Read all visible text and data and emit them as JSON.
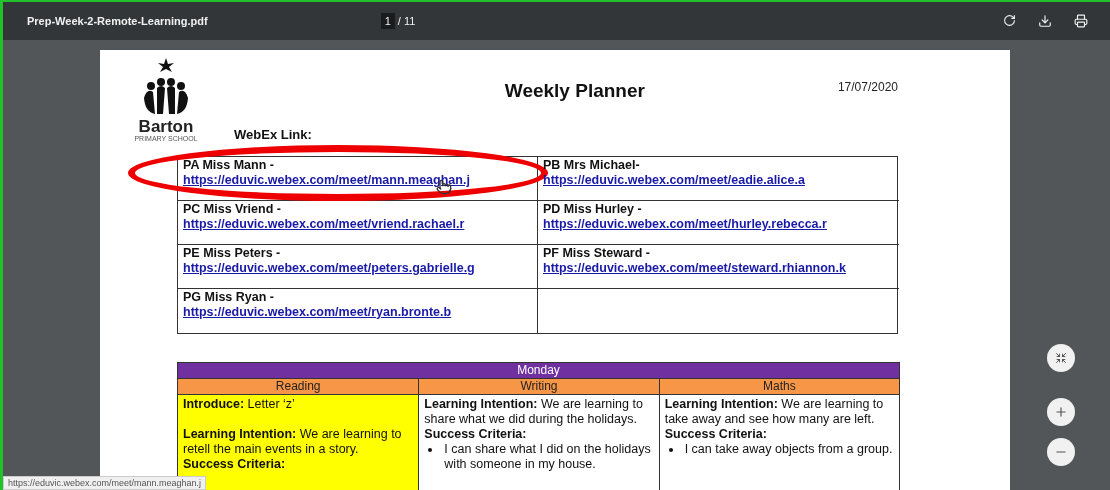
{
  "viewer": {
    "file_name": "Prep-Week-2-Remote-Learning.pdf",
    "page_current": "1",
    "page_total": "/ 11"
  },
  "document": {
    "school": {
      "name": "Barton",
      "subtitle": "PRIMARY SCHOOL"
    },
    "title": "Weekly Planner",
    "date": "17/07/2020",
    "links_heading": "WebEx Link:",
    "links": [
      {
        "teacher": "PA Miss Mann -",
        "url": "https://eduvic.webex.com/meet/mann.meaghan.j",
        "circled": true
      },
      {
        "teacher": "PB Mrs Michael-",
        "url": "https://eduvic.webex.com/meet/eadie.alice.a",
        "circled": false
      },
      {
        "teacher": "PC Miss Vriend -",
        "url": "https://eduvic.webex.com/meet/vriend.rachael.r",
        "circled": false
      },
      {
        "teacher": "PD Miss Hurley -",
        "url": "https://eduvic.webex.com/meet/hurley.rebecca.r",
        "circled": false
      },
      {
        "teacher": "PE Miss Peters -",
        "url": "https://eduvic.webex.com/meet/peters.gabrielle.g",
        "circled": false
      },
      {
        "teacher": "PF Miss Steward -",
        "url": "https://eduvic.webex.com/meet/steward.rhiannon.k",
        "circled": false
      },
      {
        "teacher": "PG Miss Ryan -",
        "url": "https://eduvic.webex.com/meet/ryan.bronte.b",
        "circled": false
      }
    ],
    "day": "Monday",
    "subjects": [
      {
        "heading": "Reading",
        "color": "#ffff00",
        "blocks": [
          {
            "kind": "intro",
            "text": "**Introduce:** Letter ‘z’"
          },
          {
            "kind": "paragraph",
            "text": "**Learning Intention:** We are learning to retell the main events in a story."
          },
          {
            "kind": "heading",
            "text": "Success Criteria:"
          }
        ]
      },
      {
        "heading": "Writing",
        "color": "#ffffff",
        "blocks": [
          {
            "kind": "paragraph",
            "text": "**Learning Intention:** We are learning to share what we did during the holidays."
          },
          {
            "kind": "heading",
            "text": "Success Criteria:"
          },
          {
            "kind": "bullet",
            "text": "I can share what I did on the holidays with someone in my house."
          }
        ]
      },
      {
        "heading": "Maths",
        "color": "#ffffff",
        "blocks": [
          {
            "kind": "paragraph",
            "text": "**Learning Intention:** We are learning to take away and see how many are left."
          },
          {
            "kind": "heading",
            "text": "Success Criteria:"
          },
          {
            "kind": "bullet",
            "text": "I can take away objects from a group."
          }
        ]
      }
    ]
  },
  "status_link": "https://eduvic.webex.com/meet/mann.meaghan.j"
}
